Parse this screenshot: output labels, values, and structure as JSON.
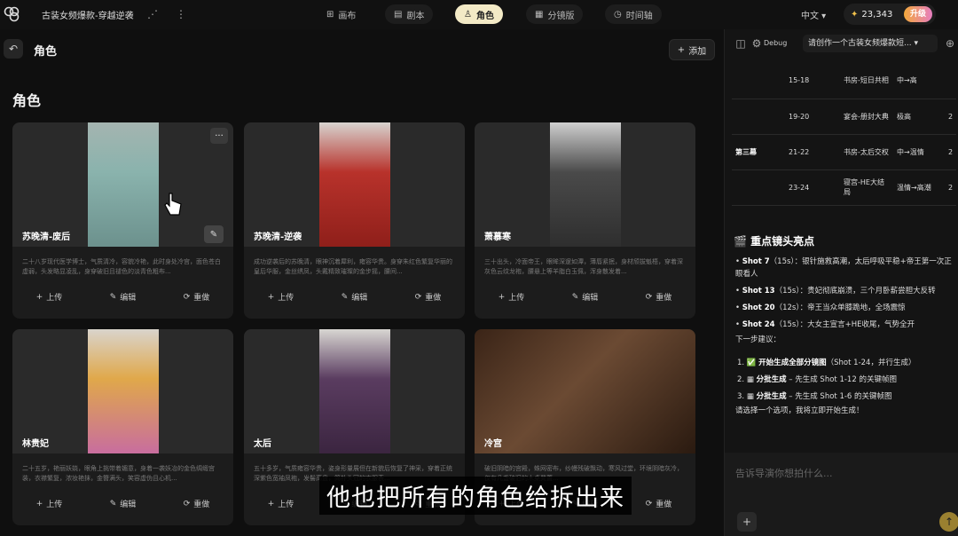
{
  "header": {
    "project_title": "古装女频爆款-穿越逆袭",
    "tabs": [
      {
        "icon": "canvas-icon",
        "label": "画布"
      },
      {
        "icon": "script-icon",
        "label": "剧本"
      },
      {
        "icon": "person-icon",
        "label": "角色",
        "active": true
      },
      {
        "icon": "storyboard-icon",
        "label": "分镜版"
      },
      {
        "icon": "timeline-icon",
        "label": "时间轴"
      }
    ],
    "language": "中文",
    "credits": "23,343",
    "upgrade": "升级"
  },
  "page": {
    "title": "角色",
    "add_label": "添加",
    "section_title": "角色"
  },
  "actions": {
    "upload": "上传",
    "edit": "编辑",
    "redo": "重做"
  },
  "cards": [
    {
      "name": "苏晚清-废后",
      "desc": "二十八岁现代医学博士，气质清冷，容貌冷艳，此时身处冷宫，面色苍白虚弱，头发略显凌乱，身穿破旧且褪色的淡青色粗布...",
      "color": "#8fb7b4"
    },
    {
      "name": "苏晚清-逆袭",
      "desc": "成功逆袭后的苏晚清，眼神沉着犀利，雍容华贵。身穿朱红色繁复华丽的皇后华服，金丝绣凤，头戴精致璀璨的金步摇，腰间...",
      "color": "#b8322b"
    },
    {
      "name": "萧慕寒",
      "desc": "三十出头，冷面帝王，眼眸深邃如潭，薄唇紧抿，身材颀拔魁梧，穿着深灰色云纹龙袍，腰悬上等羊脂白玉佩，浑身散发着...",
      "color": "#4a4a4a"
    },
    {
      "name": "林贵妃",
      "desc": "二十五岁，艳丽妖娆，眼角上挑带着媚意，身着一袭妖冶的金色绸缎宫装，衣襟繁复，浓妆艳抹，金簪满头，笑容虚伪且心机...",
      "color": "#d8a24a"
    },
    {
      "name": "太后",
      "desc": "五十多岁，气质雍容华贵，姿身形量展但在新貌后恢复了神采，穿着正统深紫色宽袖凤袍，发髻高盘，简朴头冠的衣服表...",
      "color": "#5a3c60"
    },
    {
      "name": "冷宫",
      "desc": "破旧阴暗的宫殿，蛛网密布，纱幔残破飘动，寒风过堂，环境阴暗灰冷，仅有几盏破旧的木桌凳置...",
      "color": "#5a3b2a"
    }
  ],
  "subtitle": "他也把所有的角色给拆出来",
  "assistant": {
    "debug_label": "Debug",
    "prompt_dropdown": "请创作一个古装女频爆款短...",
    "table_rows": [
      {
        "act": "",
        "shots": "15-18",
        "scene": "书房-短日共相",
        "mood": "中→高",
        "extra": ""
      },
      {
        "act": "",
        "shots": "19-20",
        "scene": "宴会-册封大典",
        "mood": "极高",
        "extra": "2"
      },
      {
        "act": "第三幕",
        "shots": "21-22",
        "scene": "书房-太后交权",
        "mood": "中→温情",
        "extra": "2"
      },
      {
        "act": "",
        "shots": "23-24",
        "scene": "寝宫-HE大结局",
        "mood": "温情→高潮",
        "extra": "2"
      }
    ],
    "highlights_title": "重点镜头亮点",
    "shots": [
      {
        "label": "Shot 7",
        "text": "（15s）：银针施救高潮，太后呼吸平稳+帝王第一次正眼看人"
      },
      {
        "label": "Shot 13",
        "text": "（15s）：贵妃彻底崩溃，三个月卧薪尝胆大反转"
      },
      {
        "label": "Shot 20",
        "text": "（12s）：帝王当众单膝跪地，全场震惊"
      },
      {
        "label": "Shot 24",
        "text": "（15s）：大女主宣言+HE收尾，气势全开"
      }
    ],
    "next_title": "下一步建议：",
    "steps": [
      {
        "num": "1.",
        "badge": "✅",
        "bold": "开始生成全部分镜图",
        "rest": "（Shot 1-24，并行生成）"
      },
      {
        "num": "2.",
        "badge": "▦",
        "bold": "分批生成",
        "rest": "– 先生成 Shot 1-12 的关键帧图"
      },
      {
        "num": "3.",
        "badge": "▦",
        "bold": "分批生成",
        "rest": "– 先生成 Shot 1-6 的关键帧图"
      }
    ],
    "ask": "请选择一个选项，我将立即开始生成！",
    "input_placeholder": "告诉导演你想拍什么..."
  }
}
